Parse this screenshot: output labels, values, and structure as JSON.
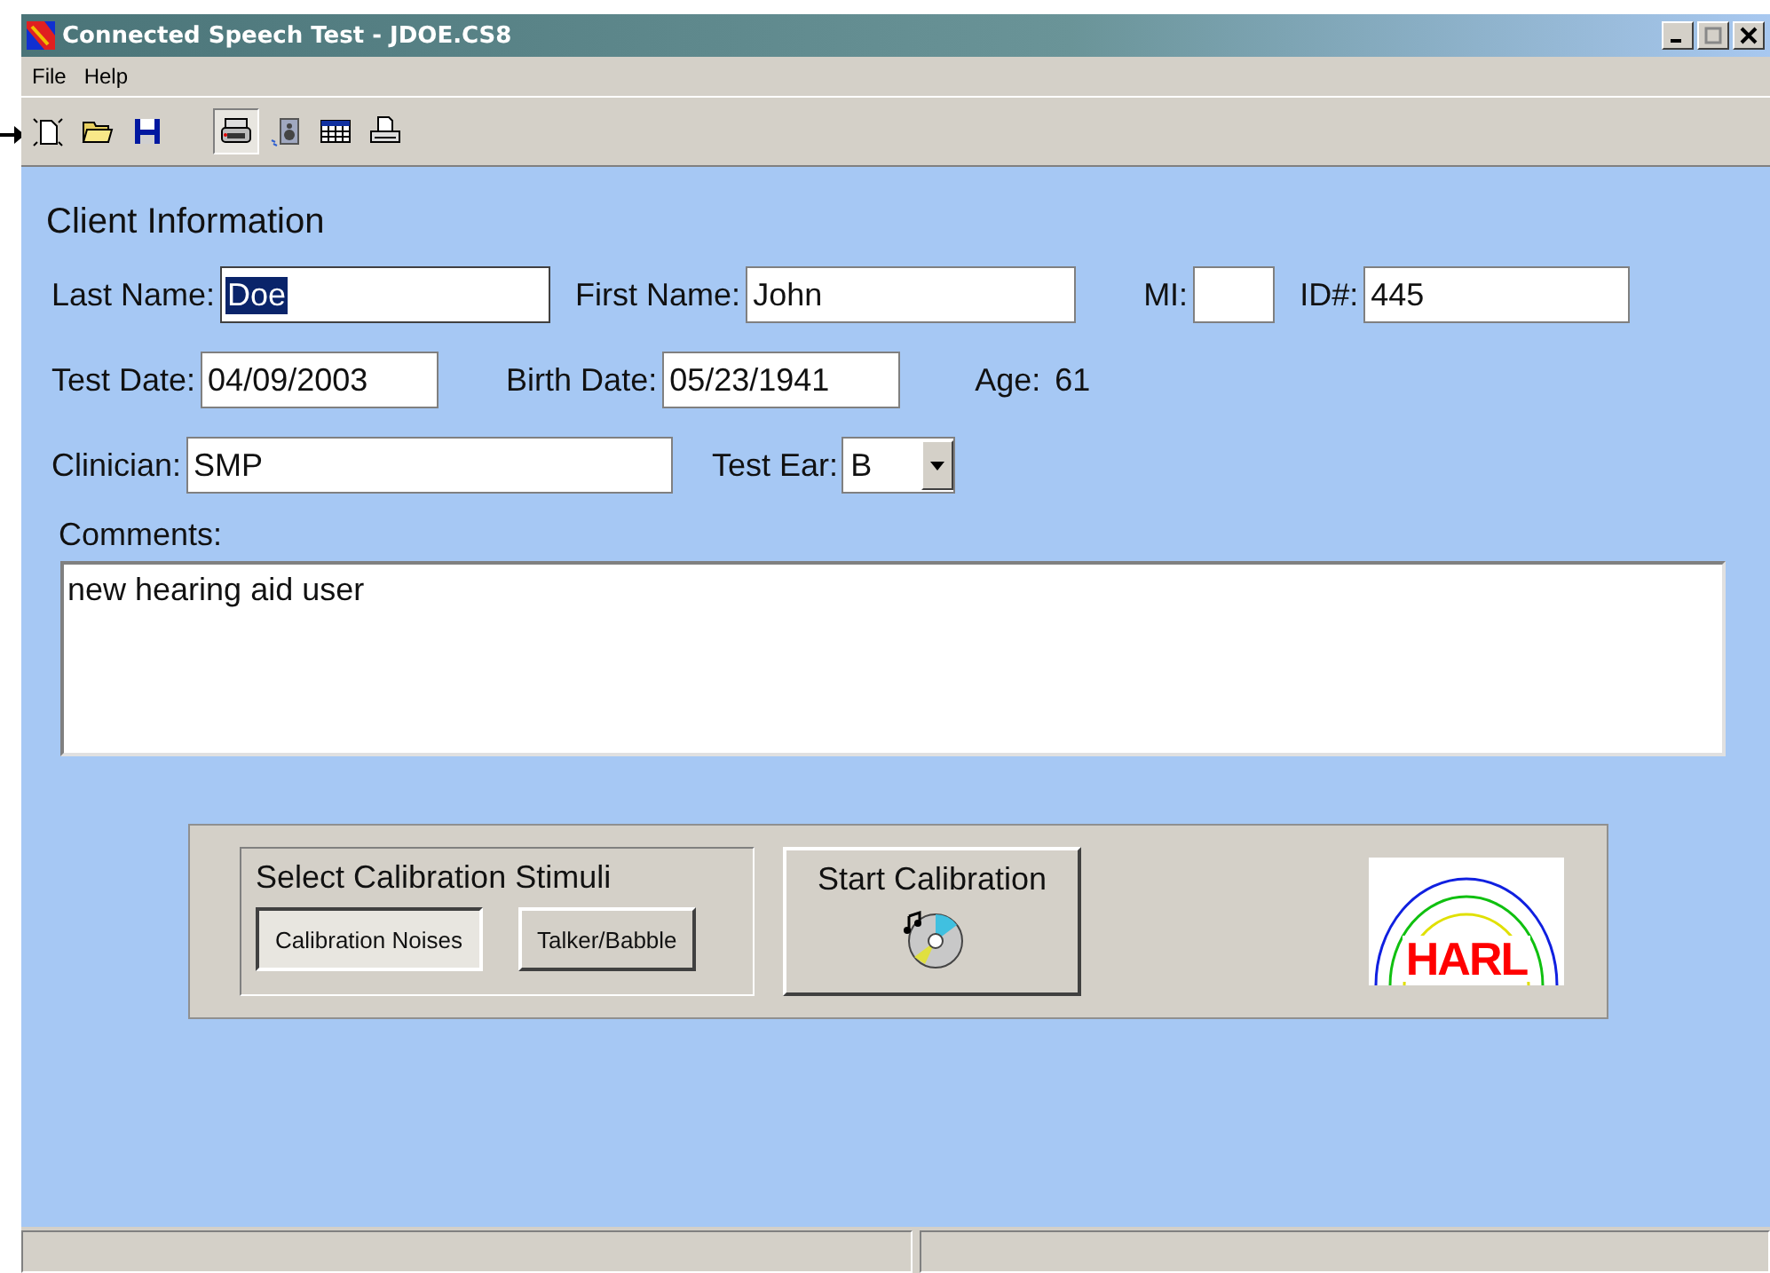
{
  "window": {
    "title": "Connected Speech Test - JDOE.CS8"
  },
  "menu": [
    "File",
    "Help"
  ],
  "toolbar": [
    {
      "kind": "new",
      "selected": false
    },
    {
      "kind": "open",
      "selected": false
    },
    {
      "kind": "save",
      "selected": false
    },
    {
      "kind": "machine",
      "selected": true
    },
    {
      "kind": "speaker",
      "selected": false
    },
    {
      "kind": "table",
      "selected": false
    },
    {
      "kind": "print",
      "selected": false
    }
  ],
  "heading": "Client Information",
  "fields": [
    [
      {
        "label": "Last Name:",
        "value": "Doe",
        "selected": true
      },
      {
        "label": "First Name:",
        "value": "John",
        "selected": false
      },
      {
        "label": "MI:",
        "selected": false
      },
      {
        "label": "ID#:",
        "value": "445",
        "selected": false
      }
    ],
    [
      {
        "label": "Test Date:",
        "value": "04/09/2003",
        "selected": false
      },
      {
        "label": "Birth Date:",
        "value": "05/23/1941",
        "selected": false
      }
    ]
  ],
  "age": {
    "label": "Age:",
    "value": "61"
  },
  "clinician": {
    "label": "Clinician:",
    "value": "SMP"
  },
  "test_ear": {
    "label": "Test Ear:",
    "value": "B"
  },
  "comments": {
    "label": "Comments:",
    "value": "new hearing aid user"
  },
  "calibration": {
    "group_title": "Select Calibration Stimuli",
    "stimuli": [
      {
        "label": "Calibration Noises",
        "selected": true
      },
      {
        "label": "Talker/Babble",
        "selected": false
      }
    ],
    "start_button": "Start Calibration",
    "logo_text": "HARL"
  }
}
